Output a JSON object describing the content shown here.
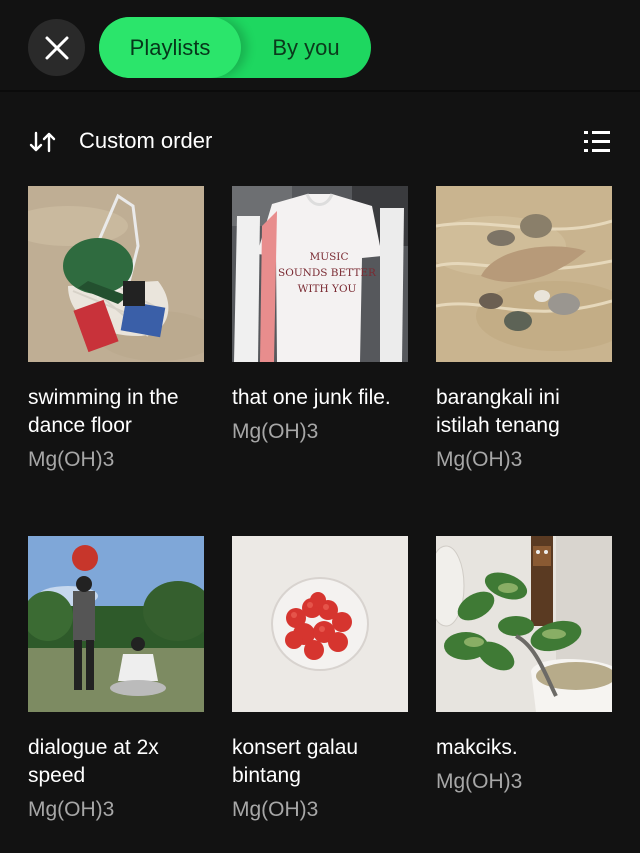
{
  "header": {
    "close_icon": "close-icon",
    "chips": {
      "active": "Playlists",
      "sub": "By you"
    },
    "colors": {
      "accent": "#1ed760",
      "background": "#121212"
    }
  },
  "sort": {
    "icon": "sort-arrows-icon",
    "label": "Custom order",
    "view_icon": "list-view-icon"
  },
  "playlists": [
    {
      "title": "swimming in the dance floor",
      "owner": "Mg(OH)3"
    },
    {
      "title": "that one junk file.",
      "owner": "Mg(OH)3",
      "shirt_text": [
        "MUSIC",
        "SOUNDS BETTER",
        "WITH YOU"
      ]
    },
    {
      "title": "barangkali ini istilah tenang",
      "owner": "Mg(OH)3"
    },
    {
      "title": "dialogue at 2x speed",
      "owner": "Mg(OH)3"
    },
    {
      "title": "konsert galau bintang",
      "owner": "Mg(OH)3"
    },
    {
      "title": "makciks.",
      "owner": "Mg(OH)3"
    }
  ]
}
